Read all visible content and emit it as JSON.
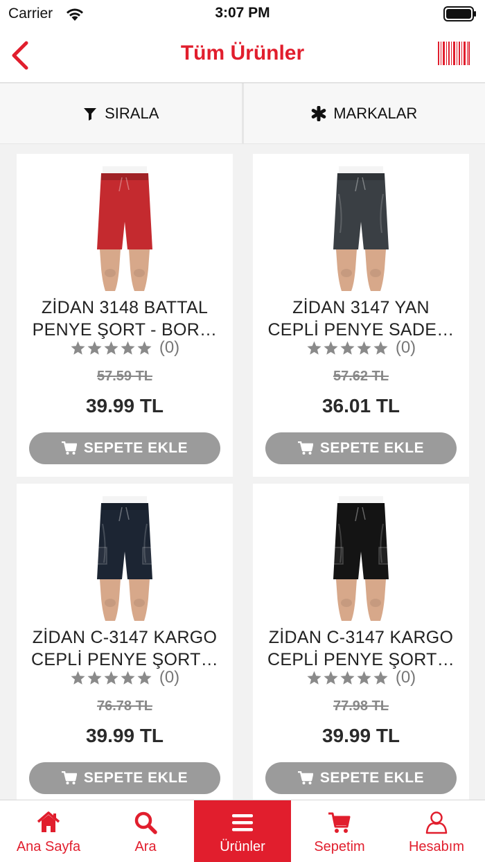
{
  "status_bar": {
    "carrier": "Carrier",
    "time": "3:07 PM"
  },
  "nav": {
    "title": "Tüm Ürünler",
    "back_icon": "chevron-left-icon",
    "barcode_icon": "barcode-icon"
  },
  "filters": [
    {
      "label": "SIRALA",
      "icon": "filter-icon"
    },
    {
      "label": "MARKALAR",
      "icon": "asterisk-icon"
    }
  ],
  "products": [
    {
      "name_line1": "ZİDAN 3148 BATTAL",
      "name_line2": "PENYE ŞORT - BOR…",
      "rating_count": "(0)",
      "old_price": "57.59 TL",
      "price": "39.99 TL",
      "button": "SEPETE EKLE",
      "shorts_color": "#c42a2f",
      "style": "plain"
    },
    {
      "name_line1": "ZİDAN 3147 YAN",
      "name_line2": "CEPLİ PENYE SADE…",
      "rating_count": "(0)",
      "old_price": "57.62 TL",
      "price": "36.01 TL",
      "button": "SEPETE EKLE",
      "shorts_color": "#3a3f44",
      "style": "pockets"
    },
    {
      "name_line1": "ZİDAN C-3147 KARGO",
      "name_line2": "CEPLİ PENYE ŞORT…",
      "rating_count": "(0)",
      "old_price": "76.78 TL",
      "price": "39.99 TL",
      "button": "SEPETE EKLE",
      "shorts_color": "#1c2533",
      "style": "cargo"
    },
    {
      "name_line1": "ZİDAN C-3147 KARGO",
      "name_line2": "CEPLİ PENYE ŞORT…",
      "rating_count": "(0)",
      "old_price": "77.98 TL",
      "price": "39.99 TL",
      "button": "SEPETE EKLE",
      "shorts_color": "#141414",
      "style": "cargo"
    }
  ],
  "tabs": [
    {
      "label": "Ana Sayfa",
      "icon": "home-icon",
      "active": false
    },
    {
      "label": "Ara",
      "icon": "search-icon",
      "active": false
    },
    {
      "label": "Ürünler",
      "icon": "menu-icon",
      "active": true
    },
    {
      "label": "Sepetim",
      "icon": "cart-icon",
      "active": false
    },
    {
      "label": "Hesabım",
      "icon": "user-icon",
      "active": false
    }
  ],
  "colors": {
    "brand": "#e11e2d",
    "button_gray": "#9b9b9b",
    "star_gray": "#8a8a8a"
  }
}
